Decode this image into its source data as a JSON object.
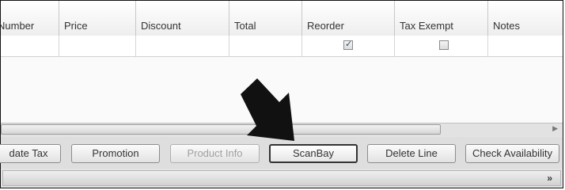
{
  "grid": {
    "columns": [
      "Number",
      "Price",
      "Discount",
      "Total",
      "Reorder",
      "Tax Exempt",
      "Notes"
    ],
    "rows": [
      {
        "reorder_checked": true,
        "tax_exempt_checked": false
      }
    ]
  },
  "buttons": {
    "update_tax": "date Tax",
    "promotion": "Promotion",
    "product_info": "Product Info",
    "scanbay": "ScanBay",
    "delete_line": "Delete Line",
    "check_availability": "Check Availability"
  },
  "icons": {
    "scroll_right": "scroll-right-arrow-icon",
    "expand": "double-chevron-down-icon",
    "pointer": "pointer-arrow-icon"
  },
  "colors": {
    "arrow": "#111111"
  }
}
